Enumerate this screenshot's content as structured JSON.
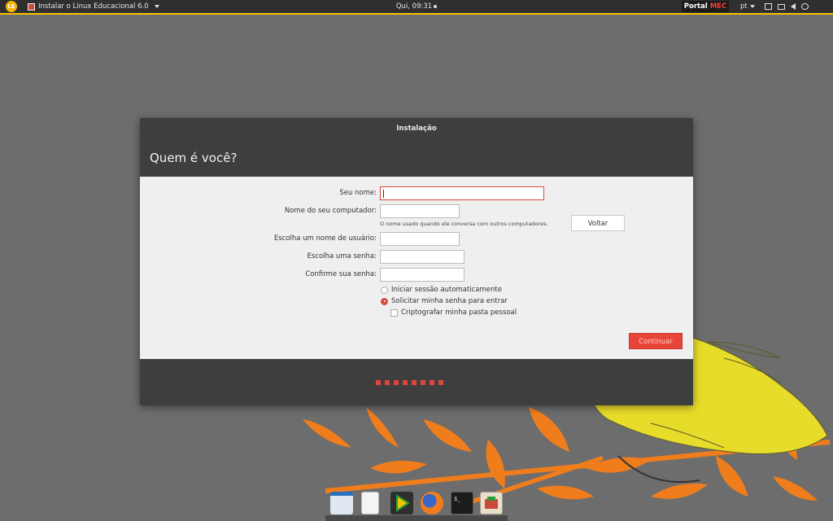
{
  "topbar": {
    "logo": "LE",
    "app_title": "Instalar o Linux Educacional 6.0",
    "clock": "Qui, 09:31",
    "portal": "Portal",
    "portal_brand": "MEC",
    "language": "pt"
  },
  "window": {
    "title": "Instalação",
    "heading": "Quem é você?",
    "form": {
      "name_label": "Seu nome:",
      "name_value": "",
      "computer_label": "Nome do seu computador:",
      "computer_value": "",
      "computer_hint": "O nome usado quando ele conversa com outros computadores.",
      "username_label": "Escolha um nome de usuário:",
      "username_value": "",
      "password_label": "Escolha uma senha:",
      "confirm_label": "Confirme sua senha:",
      "auto_login_label": "Iniciar sessão automaticamente",
      "ask_password_label": "Solicitar minha senha para entrar",
      "encrypt_label": "Criptografar minha pasta pessoal",
      "selected_login_option": "ask_password",
      "encrypt_checked": false
    },
    "buttons": {
      "back": "Voltar",
      "continue": "Continuar"
    },
    "progress_steps": 8
  },
  "dock": {
    "items": [
      "file-manager-icon",
      "text-editor-icon",
      "media-player-icon",
      "firefox-icon",
      "terminal-icon",
      "package-manager-icon"
    ]
  },
  "colors": {
    "accent": "#e8453a",
    "topbar": "#2f2f2f",
    "topbar_line": "#f3c400",
    "desktop": "#6d6d6d",
    "window_dark": "#3e3e3e",
    "content_bg": "#efefef"
  }
}
